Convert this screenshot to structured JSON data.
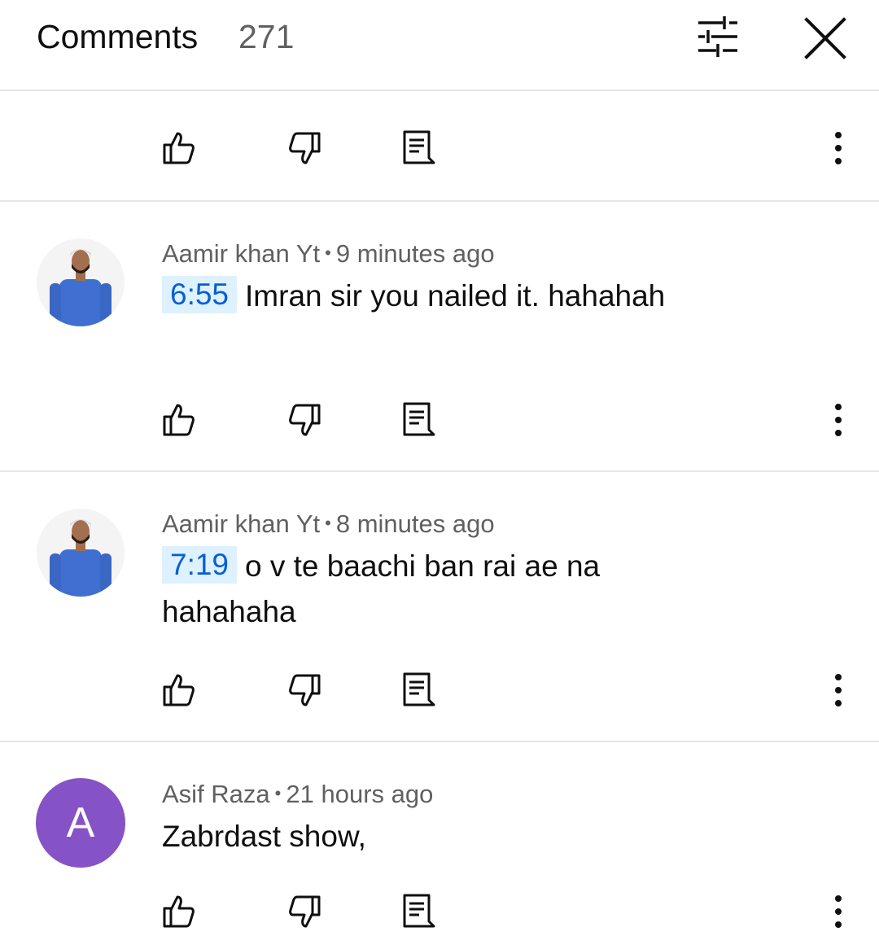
{
  "header": {
    "title": "Comments",
    "count": "271",
    "icons": [
      "filter-icon",
      "close-icon"
    ]
  },
  "comments": [
    {
      "author": "",
      "time": "",
      "timestamp": "",
      "text": "",
      "avatar": {
        "type": "none"
      }
    },
    {
      "author": "Aamir khan Yt",
      "time": "9 minutes ago",
      "timestamp": "6:55",
      "text": "Imran sir you nailed it. hahahah",
      "avatar": {
        "type": "photo"
      }
    },
    {
      "author": "Aamir khan Yt",
      "time": "8 minutes ago",
      "timestamp": "7:19",
      "text": "o v te baachi ban rai ae na hahahaha",
      "avatar": {
        "type": "photo"
      }
    },
    {
      "author": "Asif Raza",
      "time": "21 hours ago",
      "timestamp": "",
      "text": "Zabrdast show,",
      "avatar": {
        "type": "letter",
        "letter": "A",
        "color": "#8653c6"
      }
    }
  ],
  "colors": {
    "timestamp_text": "#065fd4",
    "timestamp_bg": "#def1ff",
    "meta_text": "#606060",
    "divider": "#e5e5e5"
  }
}
